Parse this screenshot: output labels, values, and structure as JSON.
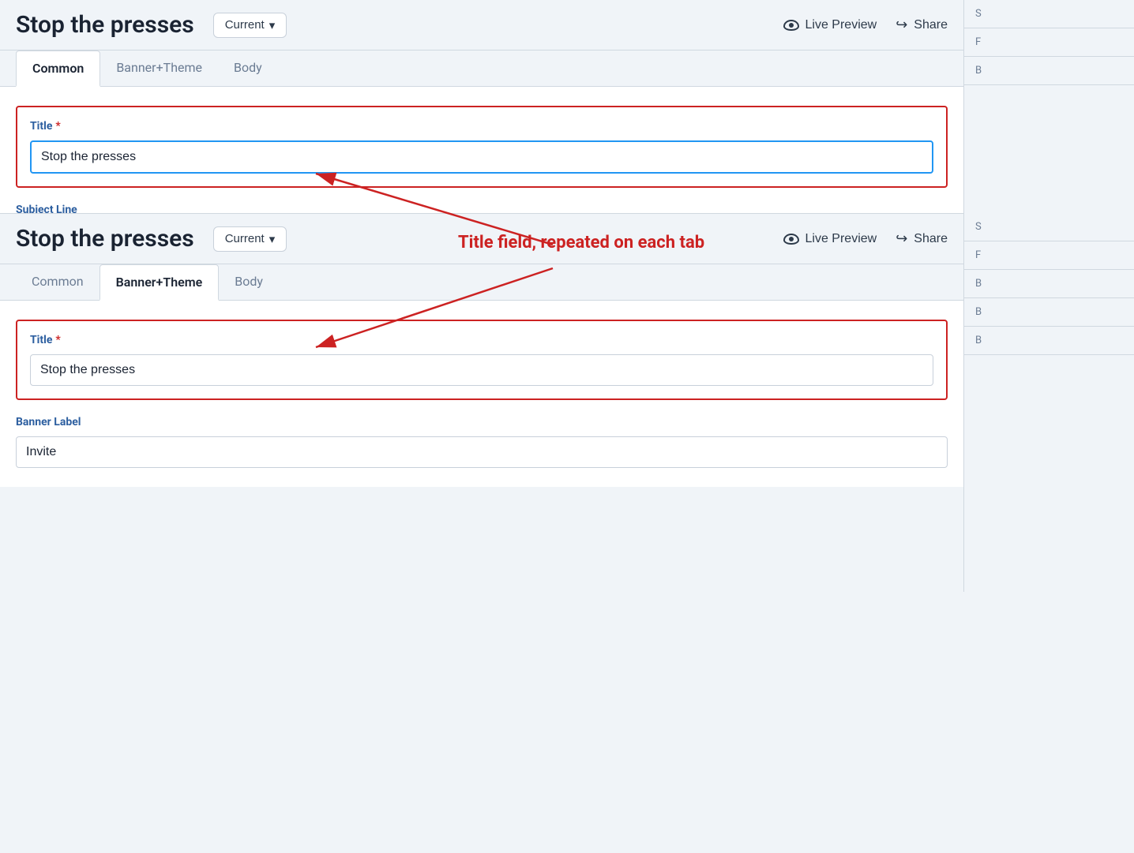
{
  "page": {
    "title": "Stop the presses"
  },
  "panel1": {
    "title": "Stop the presses",
    "version_label": "Current",
    "version_chevron": "▾",
    "live_preview_label": "Live Preview",
    "share_label": "Share",
    "tabs": [
      {
        "id": "common",
        "label": "Common",
        "active": true
      },
      {
        "id": "banner-theme",
        "label": "Banner+Theme",
        "active": false
      },
      {
        "id": "body",
        "label": "Body",
        "active": false
      }
    ],
    "title_field_label": "Title",
    "title_field_required": "*",
    "title_field_value": "Stop the presses",
    "subject_line_label": "Subject Line",
    "subject_line_value": "",
    "subject_line_placeholder": ""
  },
  "annotation": {
    "text": "Title field, repeated on each tab",
    "arrow_note": "arrow pointing from annotation text to title fields"
  },
  "panel2": {
    "title": "Stop the presses",
    "version_label": "Current",
    "version_chevron": "▾",
    "live_preview_label": "Live Preview",
    "share_label": "Share",
    "tabs": [
      {
        "id": "common",
        "label": "Common",
        "active": false
      },
      {
        "id": "banner-theme",
        "label": "Banner+Theme",
        "active": true
      },
      {
        "id": "body",
        "label": "Body",
        "active": false
      }
    ],
    "title_field_label": "Title",
    "title_field_required": "*",
    "title_field_value": "Stop the presses",
    "banner_label_label": "Banner Label",
    "banner_label_value": "Invite"
  },
  "sidebar": {
    "items": [
      "S",
      "F",
      "B",
      "B",
      "B"
    ]
  }
}
